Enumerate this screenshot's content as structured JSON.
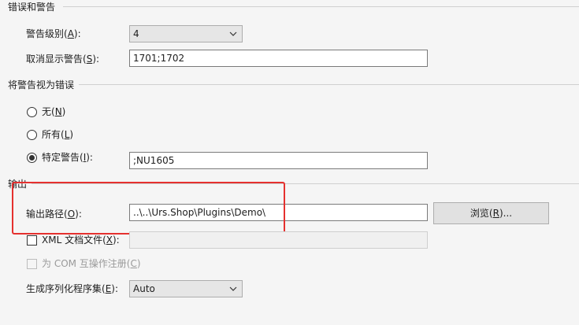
{
  "errors_section": {
    "title": "错误和警告",
    "warning_level_label": "警告级别(",
    "warning_level_key": "A",
    "warning_level_suffix": "):",
    "warning_level_value": "4",
    "suppress_label": "取消显示警告(",
    "suppress_key": "S",
    "suppress_suffix": "):",
    "suppress_value": "1701;1702"
  },
  "treat_section": {
    "title": "将警告视为错误",
    "none_label": "无(",
    "none_key": "N",
    "none_suffix": ")",
    "all_label": "所有(",
    "all_key": "L",
    "all_suffix": ")",
    "specific_label": "特定警告(",
    "specific_key": "I",
    "specific_suffix": "):",
    "specific_value": ";NU1605",
    "selected": "specific"
  },
  "output_section": {
    "title": "输出",
    "path_label": "输出路径(",
    "path_key": "O",
    "path_suffix": "):",
    "path_value": "..\\..\\Urs.Shop\\Plugins\\Demo\\",
    "browse_label": "浏览(",
    "browse_key": "R",
    "browse_suffix": ")...",
    "xml_label": "XML 文档文件(",
    "xml_key": "X",
    "xml_suffix": "):",
    "xml_value": "",
    "com_label": "为 COM 互操作注册(",
    "com_key": "C",
    "com_suffix": ")",
    "serialization_label": "生成序列化程序集(",
    "serialization_key": "E",
    "serialization_suffix": "):",
    "serialization_value": "Auto"
  },
  "colors": {
    "highlight": "#e5312f",
    "background": "#f5f5f5"
  }
}
